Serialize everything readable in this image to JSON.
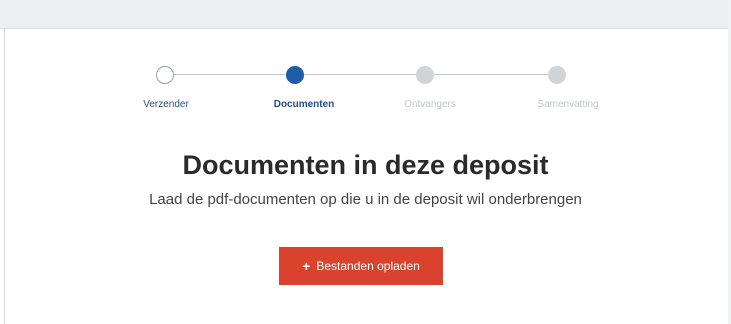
{
  "stepper": {
    "steps": [
      {
        "label": "Verzender",
        "state": "done"
      },
      {
        "label": "Documenten",
        "state": "active"
      },
      {
        "label": "Ontvangers",
        "state": "todo"
      },
      {
        "label": "Samenvatting",
        "state": "todo"
      }
    ]
  },
  "page": {
    "title": "Documenten in deze deposit",
    "subtitle": "Laad de pdf-documenten op die u in de deposit wil onderbrengen"
  },
  "upload": {
    "icon": "plus-icon",
    "label": "Bestanden opladen"
  },
  "colors": {
    "accent": "#1f5da8",
    "button": "#d9432e",
    "inactive_step": "#cfd4d7"
  }
}
